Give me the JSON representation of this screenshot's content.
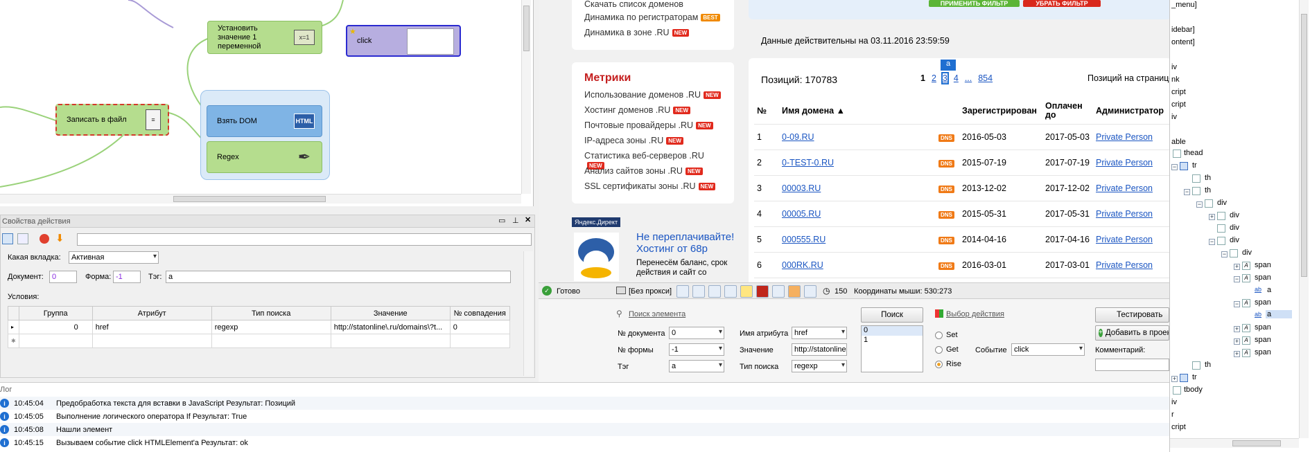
{
  "canvas": {
    "nodes": {
      "set_var": "Установить значение 1 переменной",
      "click": "click",
      "write_file": "Записать в файл",
      "get_dom": "Взять DOM",
      "regex": "Regex",
      "html_icon": "HTML"
    }
  },
  "browser": {
    "top_links": [
      "Скачать список доменов",
      "Динамика по регистраторам",
      "Динамика в зоне .RU"
    ],
    "top_badges": [
      "",
      "BEST",
      "NEW"
    ],
    "filter_apply": "ПРИМЕНИТЬ ФИЛЬТР",
    "filter_remove": "УБРАТЬ ФИЛЬТР",
    "valid_date": "Данные действительны на 03.11.2016 23:59:59",
    "metrics_title": "Метрики",
    "metrics_links": [
      "Использование доменов .RU",
      "Хостинг доменов .RU",
      "Почтовые провайдеры .RU",
      "IP-адреса зоны .RU",
      "Статистика веб-серверов .RU",
      "Анализ сайтов зоны .RU",
      "SSL сертификаты зоны .RU"
    ],
    "badge_new": "NEW",
    "yandex_direct": "Яндекс.Директ",
    "ad_title": "Не переплачивайте! Хостинг от 68р",
    "ad_text": "Перенесём баланс, срок действия и сайт со",
    "positions": "Позиций: 170783",
    "pages": [
      "1",
      "2",
      "3",
      "4",
      "...",
      "854"
    ],
    "tooltip": "a",
    "per_page": "Позиций на странице",
    "columns": [
      "№",
      "Имя домена ▲",
      "",
      "Зарегистрирован",
      "Оплачен до",
      "Администратор"
    ],
    "rows": [
      {
        "n": "1",
        "domain": "0-09.RU",
        "reg": "2016-05-03",
        "paid": "2017-05-03",
        "admin": "Private Person"
      },
      {
        "n": "2",
        "domain": "0-TEST-0.RU",
        "reg": "2015-07-19",
        "paid": "2017-07-19",
        "admin": "Private Person"
      },
      {
        "n": "3",
        "domain": "00003.RU",
        "reg": "2013-12-02",
        "paid": "2017-12-02",
        "admin": "Private Person"
      },
      {
        "n": "4",
        "domain": "00005.RU",
        "reg": "2015-05-31",
        "paid": "2017-05-31",
        "admin": "Private Person"
      },
      {
        "n": "5",
        "domain": "000555.RU",
        "reg": "2014-04-16",
        "paid": "2017-04-16",
        "admin": "Private Person"
      },
      {
        "n": "6",
        "domain": "000RK.RU",
        "reg": "2016-03-01",
        "paid": "2017-03-01",
        "admin": "Private Person"
      }
    ],
    "dns": "DNS"
  },
  "status": {
    "ready": "Готово",
    "proxy": "[Без прокси]",
    "count": "150",
    "coords": "Координаты мыши: 530:273"
  },
  "search": {
    "find_element": "Поиск элемента",
    "doc_label": "№ документа",
    "doc_value": "0",
    "form_label": "№ формы",
    "form_value": "-1",
    "tag_label": "Тэг",
    "tag_value": "a",
    "attr_label": "Имя атрибута",
    "attr_value": "href",
    "value_label": "Значение",
    "value_value": "http://statonline",
    "type_label": "Тип поиска",
    "type_value": "regexp",
    "search_btn": "Поиск",
    "results": [
      "0",
      "1"
    ],
    "choose_action": "Выбор действия",
    "set": "Set",
    "get": "Get",
    "rise": "Rise",
    "event_label": "Событие",
    "event_value": "click",
    "test_btn": "Тестировать",
    "add_btn": "Добавить в проект",
    "comment_label": "Комментарий:"
  },
  "props": {
    "title": "Свойства действия",
    "tab_label": "Какая вкладка:",
    "tab_value": "Активная",
    "doc_label": "Документ:",
    "doc_value": "0",
    "form_label": "Форма:",
    "form_value": "-1",
    "tag_label": "Тэг:",
    "tag_value": "a",
    "conditions": "Условия:",
    "columns": [
      "Группа",
      "Атрибут",
      "Тип поиска",
      "Значение",
      "№ совпадения"
    ],
    "row": {
      "group": "0",
      "attr": "href",
      "type": "regexp",
      "value": "http://statonline\\.ru/domains\\?t...",
      "match": "0"
    }
  },
  "log": {
    "title": "Лог",
    "rows": [
      {
        "time": "10:45:04",
        "text": "Предобработка текста для вставки в JavaScript Результат: Позиций"
      },
      {
        "time": "10:45:05",
        "text": "Выполнение логического оператора If  Результат: True"
      },
      {
        "time": "10:45:08",
        "text": " Нашли элемент"
      },
      {
        "time": "10:45:15",
        "text": "Вызываем событие click HTMLElement'a  Результат: ok"
      }
    ]
  },
  "tree": {
    "top": [
      "_menu]",
      "idebar]",
      "ontent]",
      "iv",
      "nk",
      "cript",
      "cript",
      "iv",
      "able"
    ],
    "nodes": [
      "thead",
      "tr",
      "th",
      "th",
      "div",
      "div",
      "div",
      "div",
      "div",
      "span",
      "span",
      "a",
      "span",
      "a",
      "span",
      "span",
      "span",
      "th",
      "tr",
      "tbody"
    ],
    "bottom": [
      "iv",
      "r",
      "cript"
    ]
  },
  "colors": {
    "accent_red": "#c41e1e",
    "green_node": "#b5dd8e",
    "blue_node": "#7fb4e5",
    "link": "#1a55c2"
  }
}
